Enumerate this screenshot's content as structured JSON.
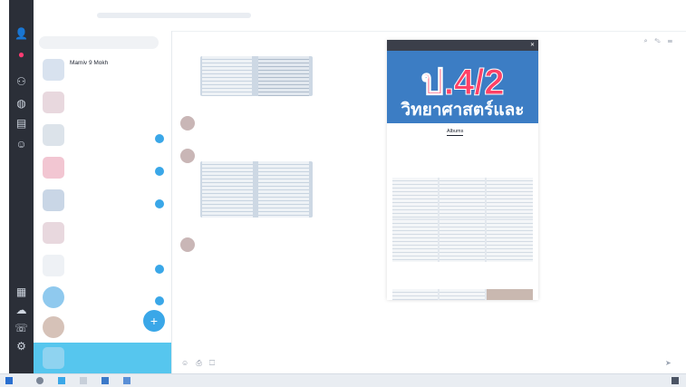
{
  "app": {
    "title": "",
    "subtitle": ""
  },
  "rail": {
    "icons": [
      "user-icon",
      "chat-bubble-icon",
      "contacts-icon",
      "globe-icon",
      "news-icon",
      "smile-icon",
      "chart-icon",
      "cloud-icon",
      "phone-icon",
      "settings-icon"
    ]
  },
  "chatlist": {
    "search_placeholder": "",
    "items": [
      {
        "name": "Mamiv 9 Mokh",
        "preview": "",
        "badge": ""
      },
      {
        "name": "",
        "preview": "",
        "badge": ""
      },
      {
        "name": "",
        "preview": "",
        "badge": ""
      },
      {
        "name": "",
        "preview": "",
        "badge": ""
      },
      {
        "name": "",
        "preview": "",
        "badge": ""
      },
      {
        "name": "",
        "preview": "",
        "badge": ""
      },
      {
        "name": "",
        "preview": "",
        "badge": ""
      },
      {
        "name": "",
        "preview": "",
        "badge": ""
      },
      {
        "name": "",
        "preview": "",
        "badge": ""
      },
      {
        "name": "",
        "preview": "",
        "badge": ""
      }
    ]
  },
  "chat": {
    "title": "",
    "messages": [
      {
        "sender": "",
        "text": ""
      },
      {
        "sender": "",
        "text": ""
      },
      {
        "sender": "",
        "text": ""
      }
    ]
  },
  "album_panel": {
    "title": "",
    "cover_big": "ป.4/2",
    "cover_sub": "วิทยาศาสตร์และ",
    "tabs": [
      "",
      "Albums",
      ""
    ],
    "album1_label": "",
    "album2_label": ""
  },
  "taskbar": {
    "time": "",
    "date": ""
  },
  "colors": {
    "accent": "#3aa7e8",
    "selected": "#56c6ee",
    "rail": "#2b2f38",
    "cover_pink": "#ff4166",
    "cover_blue": "#3c7dc4"
  }
}
